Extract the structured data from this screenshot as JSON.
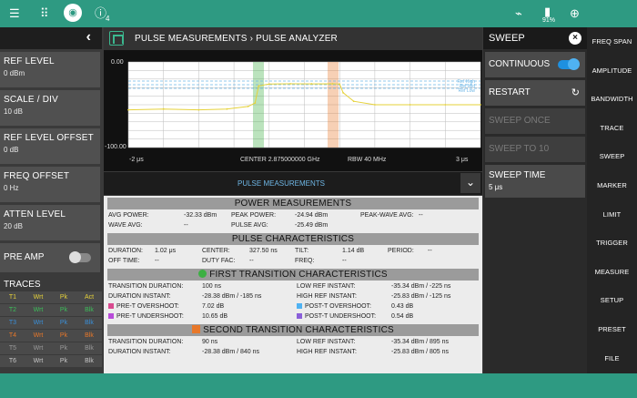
{
  "status_bar": {
    "notification_count": "4",
    "battery_percent": "91%",
    "icons": [
      "menu-icon",
      "apps-grid-icon",
      "camera-icon",
      "info-icon",
      "wifi-off-icon",
      "battery-icon",
      "location-icon"
    ]
  },
  "left_panel": {
    "params": [
      {
        "label": "REF LEVEL",
        "value": "0 dBm"
      },
      {
        "label": "SCALE / DIV",
        "value": "10 dB"
      },
      {
        "label": "REF LEVEL OFFSET",
        "value": "0 dB"
      },
      {
        "label": "FREQ OFFSET",
        "value": "0 Hz"
      },
      {
        "label": "ATTEN LEVEL",
        "value": "20 dB"
      }
    ],
    "pre_amp_label": "PRE AMP",
    "traces_title": "TRACES",
    "traces": [
      {
        "name": "T1",
        "mode": "Wrt",
        "det": "Pk",
        "state": "Act",
        "color": "#e6d23a"
      },
      {
        "name": "T2",
        "mode": "Wrt",
        "det": "Pk",
        "state": "Blk",
        "color": "#3cbf5a"
      },
      {
        "name": "T3",
        "mode": "Wrt",
        "det": "Pk",
        "state": "Blk",
        "color": "#3a8fd8"
      },
      {
        "name": "T4",
        "mode": "Wrt",
        "det": "Pk",
        "state": "Blk",
        "color": "#e8782a"
      },
      {
        "name": "T5",
        "mode": "Wrt",
        "det": "Pk",
        "state": "Blk",
        "color": "#9a9a9a"
      },
      {
        "name": "T6",
        "mode": "Wrt",
        "det": "Pk",
        "state": "Blk",
        "color": "#c7c7c7"
      }
    ]
  },
  "header": {
    "breadcrumb": "PULSE MEASUREMENTS  ›  PULSE ANALYZER"
  },
  "chart": {
    "y_top": "0.00",
    "y_bottom": "-100.00",
    "x_start": "-2 μs",
    "center": "CENTER 2.875000000 GHz",
    "rbw": "RBW 40 MHz",
    "x_end": "3 μs",
    "ref_labels": [
      "Ref High",
      "Ref Mid",
      "Ref Low"
    ]
  },
  "chart_data": {
    "type": "line",
    "xlabel": "",
    "ylabel": "",
    "xlim": [
      -2,
      3
    ],
    "ylim": [
      -100,
      0
    ],
    "series": [
      {
        "x": [
          -2,
          -1.5,
          -1.0,
          -0.6,
          -0.3,
          -0.2,
          -0.15,
          0.0,
          0.3,
          0.6,
          0.9,
          1.0,
          1.05,
          1.2,
          1.5,
          2.0,
          2.5,
          3.0
        ],
        "values": [
          -56,
          -55,
          -56,
          -55,
          -52,
          -48,
          -28,
          -25.8,
          -25.5,
          -25.6,
          -25.5,
          -25.8,
          -36,
          -46,
          -50,
          -50,
          -50,
          -50
        ]
      }
    ]
  },
  "tab_bar": {
    "label": "PULSE MEASUREMENTS"
  },
  "table": {
    "power_title": "POWER MEASUREMENTS",
    "avg_power_label": "AVG POWER:",
    "avg_power": "-32.33 dBm",
    "peak_power_label": "PEAK POWER:",
    "peak_power": "-24.94 dBm",
    "peak_wave_avg_label": "PEAK-WAVE AVG:",
    "peak_wave_avg": "--",
    "wave_avg_label": "WAVE AVG:",
    "wave_avg": "--",
    "pulse_avg_label": "PULSE AVG:",
    "pulse_avg": "-25.49 dBm",
    "pulse_title": "PULSE CHARACTERISTICS",
    "duration_label": "DURATION:",
    "duration": "1.02 μs",
    "center_label": "CENTER:",
    "center": "327.50 ns",
    "tilt_label": "TILT:",
    "tilt": "1.14 dB",
    "period_label": "PERIOD:",
    "period": "--",
    "off_time_label": "OFF TIME:",
    "off_time": "--",
    "duty_fac_label": "DUTY FAC:",
    "duty_fac": "--",
    "freq_label": "FREQ:",
    "freq": "--",
    "first_title": "FIRST TRANSITION CHARACTERISTICS",
    "t1_dur_label": "TRANSITION DURATION:",
    "t1_dur": "100 ns",
    "t1_low_label": "LOW REF INSTANT:",
    "t1_low": "-35.34 dBm / -225 ns",
    "t1_dinst_label": "DURATION INSTANT:",
    "t1_dinst": "-28.38 dBm / -185 ns",
    "t1_high_label": "HIGH REF INSTANT:",
    "t1_high": "-25.83 dBm / -125 ns",
    "t1_preo_label": "PRE-T OVERSHOOT:",
    "t1_preo": "7.02 dB",
    "t1_posto_label": "POST-T OVERSHOOT:",
    "t1_posto": "0.43 dB",
    "t1_preu_label": "PRE-T UNDERSHOOT:",
    "t1_preu": "10.65 dB",
    "t1_postu_label": "POST-T UNDERSHOOT:",
    "t1_postu": "0.54 dB",
    "second_title": "SECOND TRANSITION CHARACTERISTICS",
    "t2_dur_label": "TRANSITION DURATION:",
    "t2_dur": "90 ns",
    "t2_low_label": "LOW REF INSTANT:",
    "t2_low": "-35.34 dBm / 895 ns",
    "t2_dinst_label": "DURATION INSTANT:",
    "t2_dinst": "-28.38 dBm / 840 ns",
    "t2_high_label": "HIGH REF INSTANT:",
    "t2_high": "-25.83 dBm / 805 ns"
  },
  "sweep": {
    "title": "SWEEP",
    "continuous": "CONTINUOUS",
    "restart": "RESTART",
    "sweep_once": "SWEEP ONCE",
    "sweep_to": "SWEEP TO 10",
    "sweep_time": "SWEEP TIME",
    "sweep_time_value": "5 μs"
  },
  "right_menu": [
    "FREQ SPAN",
    "AMPLITUDE",
    "BANDWIDTH",
    "TRACE",
    "SWEEP",
    "MARKER",
    "LIMIT",
    "TRIGGER",
    "MEASURE",
    "SETUP",
    "PRESET",
    "FILE"
  ],
  "colors": {
    "brand_green": "#2e9a82",
    "accent_blue": "#1e90e0",
    "trace_yellow": "#e6d23a",
    "first_transition": "#3cb043",
    "second_transition": "#e8782a"
  }
}
